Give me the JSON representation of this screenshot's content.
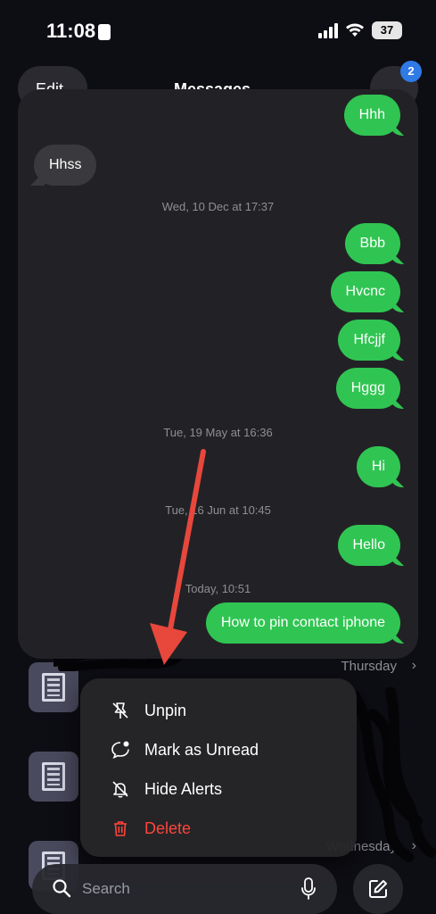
{
  "status_bar": {
    "time": "11:08",
    "battery": "37"
  },
  "header": {
    "edit_label": "Edit",
    "title": "Messages",
    "filter_badge": "2"
  },
  "preview": {
    "items": [
      {
        "kind": "out",
        "text": "Hhh"
      },
      {
        "kind": "in",
        "text": "Hhss"
      },
      {
        "kind": "ts",
        "text": "Wed, 10 Dec at 17:37"
      },
      {
        "kind": "out",
        "text": "Bbb"
      },
      {
        "kind": "out",
        "text": "Hvcnc"
      },
      {
        "kind": "out",
        "text": "Hfcjjf"
      },
      {
        "kind": "out",
        "text": "Hggg"
      },
      {
        "kind": "ts",
        "text": "Tue, 19 May at 16:36"
      },
      {
        "kind": "out",
        "text": "Hi"
      },
      {
        "kind": "ts",
        "text": "Tue, 16 Jun at 10:45"
      },
      {
        "kind": "out",
        "text": "Hello"
      },
      {
        "kind": "ts",
        "text": "Today, 10:51"
      },
      {
        "kind": "out",
        "text": "How to pin contact iphone"
      }
    ]
  },
  "background_list": {
    "rows": [
      {
        "date": "Thursday"
      },
      {
        "date": ""
      },
      {
        "date": "Wednesday"
      }
    ]
  },
  "context_menu": {
    "unpin": "Unpin",
    "mark_unread": "Mark as Unread",
    "hide_alerts": "Hide Alerts",
    "delete": "Delete"
  },
  "search": {
    "placeholder": "Search"
  },
  "colors": {
    "sent_bubble": "#30c552",
    "received_bubble": "#3a3a3e",
    "delete": "#ff453a",
    "badge": "#2f7ae5",
    "annotation_arrow": "#e8473c"
  }
}
